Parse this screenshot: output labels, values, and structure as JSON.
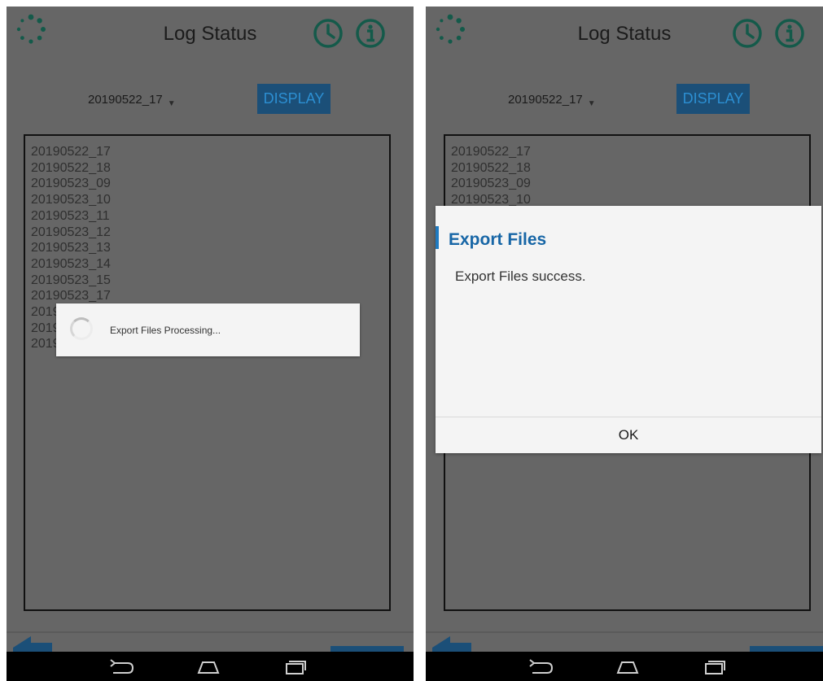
{
  "left_screen": {
    "title": "Log Status",
    "selected_date": "20190522_17",
    "display_label": "DISPLAY",
    "log_items": [
      "20190522_17",
      "20190522_18",
      "20190523_09",
      "20190523_10",
      "20190523_11",
      "20190523_12",
      "20190523_13",
      "20190523_14",
      "20190523_15",
      "20190523_17",
      "2019",
      "2019",
      "2019"
    ],
    "progress_dialog": {
      "message": "Export Files Processing..."
    }
  },
  "right_screen": {
    "title": "Log Status",
    "selected_date": "20190522_17",
    "display_label": "DISPLAY",
    "log_items": [
      "20190522_17",
      "20190522_18",
      "20190523_09",
      "20190523_10"
    ],
    "alert_dialog": {
      "title": "Export Files",
      "message": "Export Files success.",
      "ok_label": "OK"
    }
  },
  "icons": {
    "logo": "spinner-logo-icon",
    "history": "clock-icon",
    "info": "info-icon",
    "back": "back-arrow-icon",
    "nav_back": "nav-back-icon",
    "nav_home": "nav-home-icon",
    "nav_recents": "nav-recents-icon"
  },
  "colors": {
    "overlay_background": "#666666",
    "accent_teal": "#145a4a",
    "button_blue": "#1b4f78",
    "dialog_title_blue": "#1766a6"
  }
}
